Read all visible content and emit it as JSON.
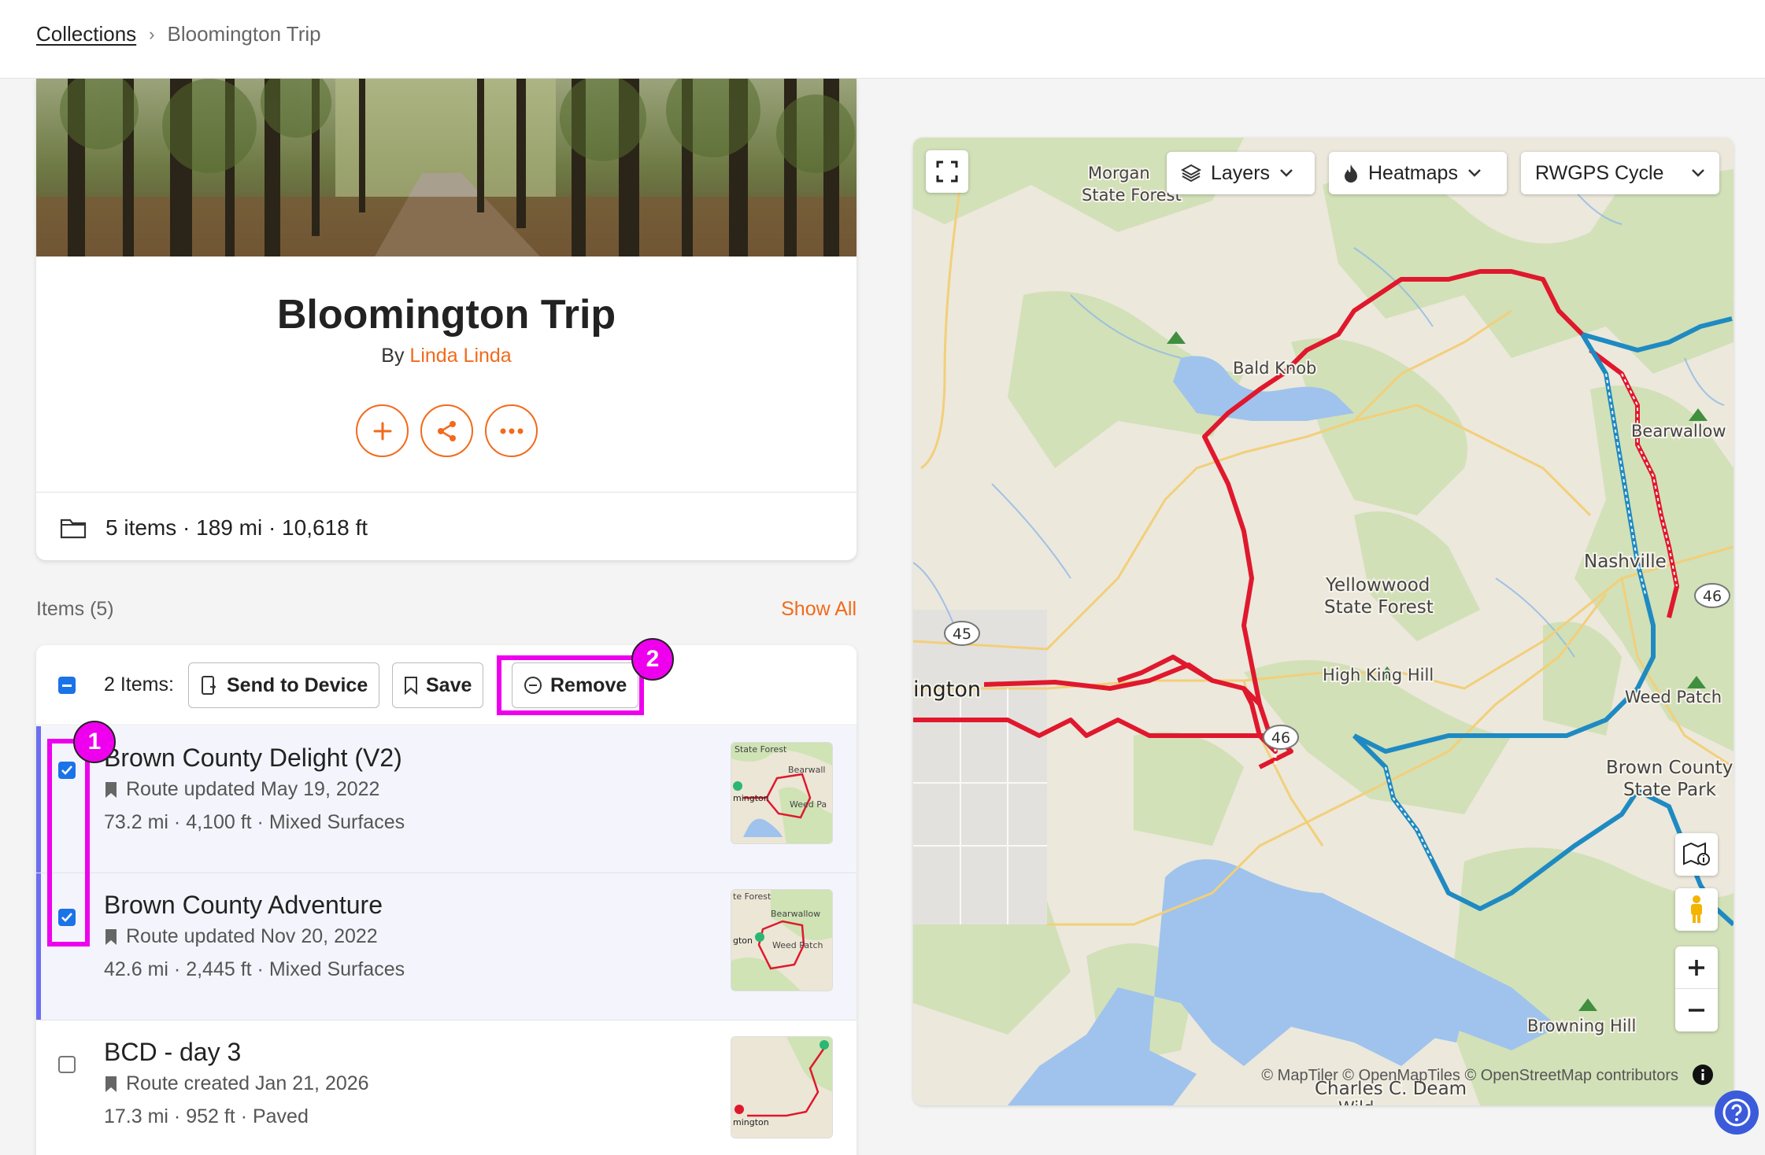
{
  "breadcrumb": {
    "root": "Collections",
    "separator": "›",
    "current": "Bloomington Trip"
  },
  "collection": {
    "title": "Bloomington Trip",
    "by_label": "By",
    "author": "Linda Linda",
    "stats": "5 items · 189 mi · 10,618 ft"
  },
  "items_section": {
    "label": "Items (5)",
    "show_all": "Show All"
  },
  "toolbar": {
    "selected_count": "2 Items:",
    "send_label": "Send to Device",
    "save_label": "Save",
    "remove_label": "Remove"
  },
  "routes": [
    {
      "name": "Brown County Delight (V2)",
      "updated": "Route updated May 19, 2022",
      "stats": "73.2 mi · 4,100 ft · Mixed Surfaces",
      "checked": true
    },
    {
      "name": "Brown County Adventure",
      "updated": "Route updated Nov 20, 2022",
      "stats": "42.6 mi · 2,445 ft · Mixed Surfaces",
      "checked": true
    },
    {
      "name": "BCD - day 3",
      "updated": "Route created Jan 21, 2026",
      "stats": "17.3 mi · 952 ft · Paved",
      "checked": false
    }
  ],
  "thumb_labels": {
    "t1": [
      "State Forest",
      "Bearwall",
      "mington",
      "Weed Pa"
    ],
    "t2": [
      "te Forest",
      "Bearwallow",
      "gton",
      "Weed Patch"
    ],
    "t3": [
      "mington"
    ]
  },
  "annotations": {
    "one": "1",
    "two": "2"
  },
  "map": {
    "layers_label": "Layers",
    "heatmaps_label": "Heatmaps",
    "style_label": "RWGPS Cycle",
    "attribution": "© MapTiler © OpenMapTiles © OpenStreetMap contributors",
    "places": {
      "morgan": "Morgan",
      "msf": "State Forest",
      "bald_knob": "Bald Knob",
      "bearwallow": "Bearwallow",
      "nashville": "Nashville",
      "yellowwood": "Yellowwood",
      "ysf": "State Forest",
      "high_king_hill": "High King Hill",
      "weed_patch": "Weed Patch",
      "brown_county": "Brown County",
      "bcsp": "State Park",
      "bloomington": "ington",
      "browning_hill": "Browning Hill",
      "charles_deam": "Charles C. Deam",
      "wild": "Wild"
    },
    "shields": {
      "s45": "45",
      "s46a": "46",
      "s46b": "46"
    }
  },
  "colors": {
    "accent": "#f26a1b",
    "highlight": "#ee00ee",
    "route_red": "#e0182d",
    "route_blue": "#1f8ac2",
    "selection": "#6d6df2"
  }
}
